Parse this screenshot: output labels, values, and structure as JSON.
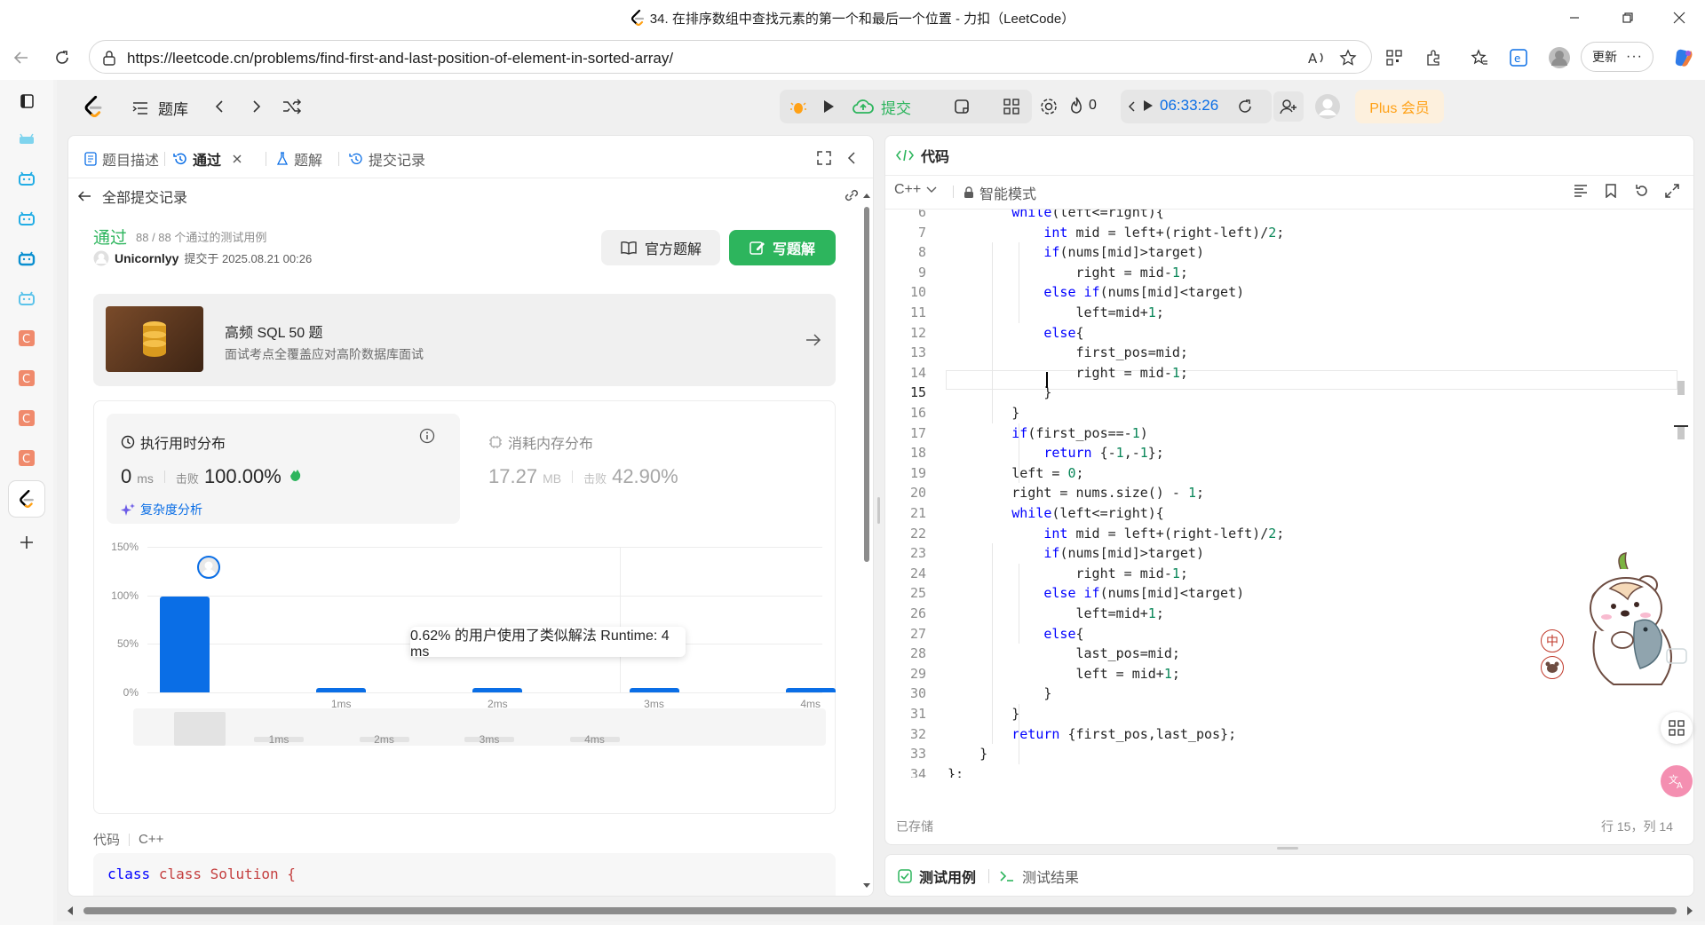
{
  "window": {
    "title": "34. 在排序数组中查找元素的第一个和最后一个位置 - 力扣（LeetCode）"
  },
  "browser": {
    "url": "https://leetcode.cn/problems/find-first-and-last-position-of-element-in-sorted-array/",
    "update_label": "更新"
  },
  "navbar": {
    "problem_list": "题库",
    "submit": "提交",
    "fire_count": "0",
    "timer": "06:33:26",
    "plus": "Plus 会员"
  },
  "left_tabs": [
    {
      "label": "题目描述"
    },
    {
      "label": "通过"
    },
    {
      "label": "题解"
    },
    {
      "label": "提交记录"
    }
  ],
  "subheader": {
    "back_label": "全部提交记录"
  },
  "result": {
    "status": "通过",
    "cases": "88 / 88 个通过的测试用例",
    "user": "Unicornlyy",
    "submitted_at": "提交于 2025.08.21 00:26",
    "official_btn": "官方题解",
    "write_btn": "写题解"
  },
  "promo": {
    "title": "高频 SQL 50 题",
    "subtitle": "面试考点全覆盖应对高阶数据库面试"
  },
  "stats": {
    "runtime_label": "执行用时分布",
    "runtime_value": "0",
    "runtime_unit": "ms",
    "beat_label": "击败",
    "runtime_beat": "100.00%",
    "complexity_link": "复杂度分析",
    "memory_label": "消耗内存分布",
    "memory_value": "17.27",
    "memory_unit": "MB",
    "memory_beat": "42.90%"
  },
  "tooltip": "0.62% 的用户使用了类似解法 Runtime: 4 ms",
  "chart_data": {
    "type": "bar",
    "categories": [
      "",
      "1ms",
      "2ms",
      "3ms",
      "4ms"
    ],
    "values": [
      99,
      2,
      2,
      2,
      2
    ],
    "ylim": [
      0,
      150
    ],
    "yticks": [
      "150%",
      "100%",
      "50%",
      "0%"
    ],
    "xlabel": "",
    "ylabel": ""
  },
  "minimap": {
    "ticks": [
      "1ms",
      "2ms",
      "3ms",
      "4ms"
    ]
  },
  "code_section": {
    "label": "代码",
    "lang": "C++",
    "first_line": "class Solution {"
  },
  "editor": {
    "tab": "代码",
    "lang": "C++",
    "mode": "智能模式",
    "saved": "已存储",
    "cursor": "行 15，列 14",
    "lines": [
      {
        "n": "6",
        "t": "        while(left<=right){"
      },
      {
        "n": "7",
        "t": "            int mid = left+(right-left)/2;"
      },
      {
        "n": "8",
        "t": "            if(nums[mid]>target)"
      },
      {
        "n": "9",
        "t": "                right = mid-1;"
      },
      {
        "n": "10",
        "t": "            else if(nums[mid]<target)"
      },
      {
        "n": "11",
        "t": "                left=mid+1;"
      },
      {
        "n": "12",
        "t": "            else{"
      },
      {
        "n": "13",
        "t": "                first_pos=mid;"
      },
      {
        "n": "14",
        "t": "                right = mid-1;"
      },
      {
        "n": "15",
        "t": "            }"
      },
      {
        "n": "16",
        "t": "        }"
      },
      {
        "n": "17",
        "t": "        if(first_pos==-1)"
      },
      {
        "n": "18",
        "t": "            return {-1,-1};"
      },
      {
        "n": "19",
        "t": "        left = 0;"
      },
      {
        "n": "20",
        "t": "        right = nums.size() - 1;"
      },
      {
        "n": "21",
        "t": "        while(left<=right){"
      },
      {
        "n": "22",
        "t": "            int mid = left+(right-left)/2;"
      },
      {
        "n": "23",
        "t": "            if(nums[mid]>target)"
      },
      {
        "n": "24",
        "t": "                right = mid-1;"
      },
      {
        "n": "25",
        "t": "            else if(nums[mid]<target)"
      },
      {
        "n": "26",
        "t": "                left=mid+1;"
      },
      {
        "n": "27",
        "t": "            else{"
      },
      {
        "n": "28",
        "t": "                last_pos=mid;"
      },
      {
        "n": "29",
        "t": "                left = mid+1;"
      },
      {
        "n": "30",
        "t": "            }"
      },
      {
        "n": "31",
        "t": "        }"
      },
      {
        "n": "32",
        "t": "        return {first_pos,last_pos};"
      },
      {
        "n": "33",
        "t": "    }"
      },
      {
        "n": "34",
        "t": "};"
      }
    ]
  },
  "bottom_tabs": {
    "testcase": "测试用例",
    "result": "测试结果"
  },
  "floating": {
    "zh": "中"
  }
}
